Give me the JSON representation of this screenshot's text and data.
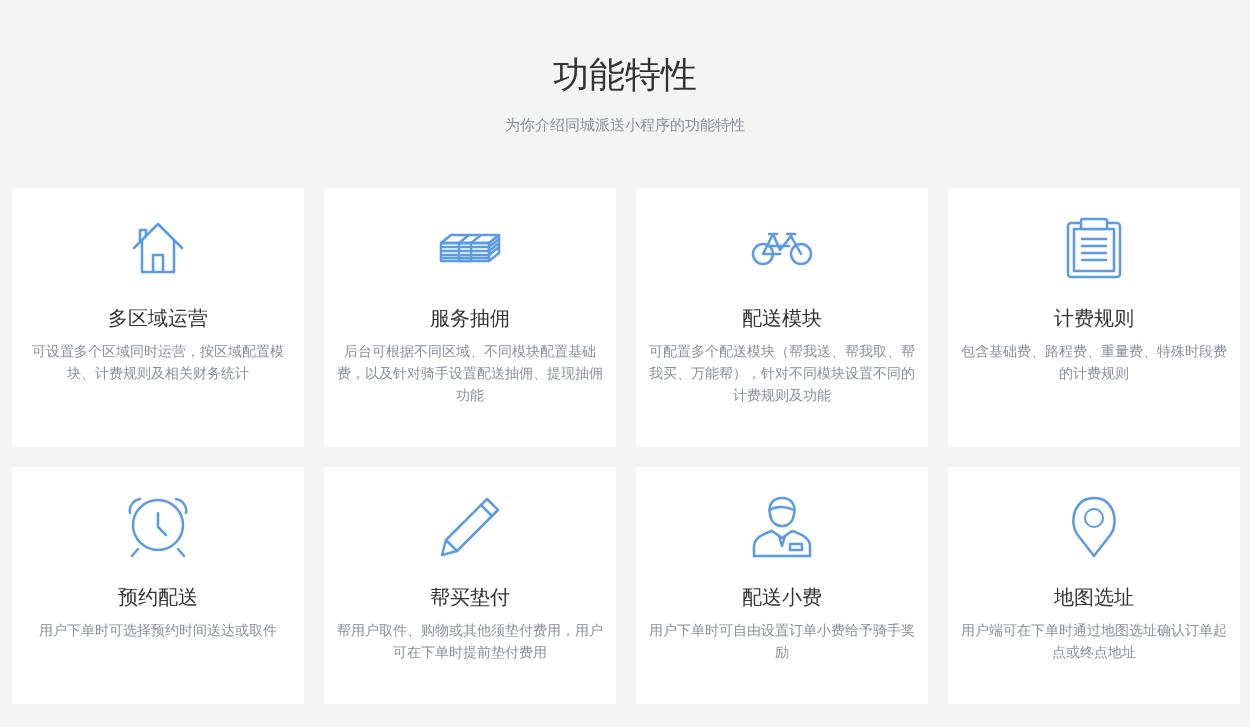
{
  "header": {
    "title": "功能特性",
    "subtitle": "为你介绍同城派送小程序的功能特性"
  },
  "features": [
    {
      "title": "多区域运营",
      "description": "可设置多个区域同时运营，按区域配置模块、计费规则及相关财务统计"
    },
    {
      "title": "服务抽佣",
      "description": "后台可根据不同区域、不同模块配置基础费，以及针对骑手设置配送抽佣、提现抽佣功能"
    },
    {
      "title": "配送模块",
      "description": "可配置多个配送模块（帮我送、帮我取、帮我买、万能帮），针对不同模块设置不同的计费规则及功能"
    },
    {
      "title": "计费规则",
      "description": "包含基础费、路程费、重量费、特殊时段费的计费规则"
    },
    {
      "title": "预约配送",
      "description": "用户下单时可选择预约时间送达或取件"
    },
    {
      "title": "帮买垫付",
      "description": "帮用户取件、购物或其他须垫付费用，用户可在下单时提前垫付费用"
    },
    {
      "title": "配送小费",
      "description": "用户下单时可自由设置订单小费给予骑手奖励"
    },
    {
      "title": "地图选址",
      "description": "用户端可在下单时通过地图选址确认订单起点或终点地址"
    }
  ]
}
